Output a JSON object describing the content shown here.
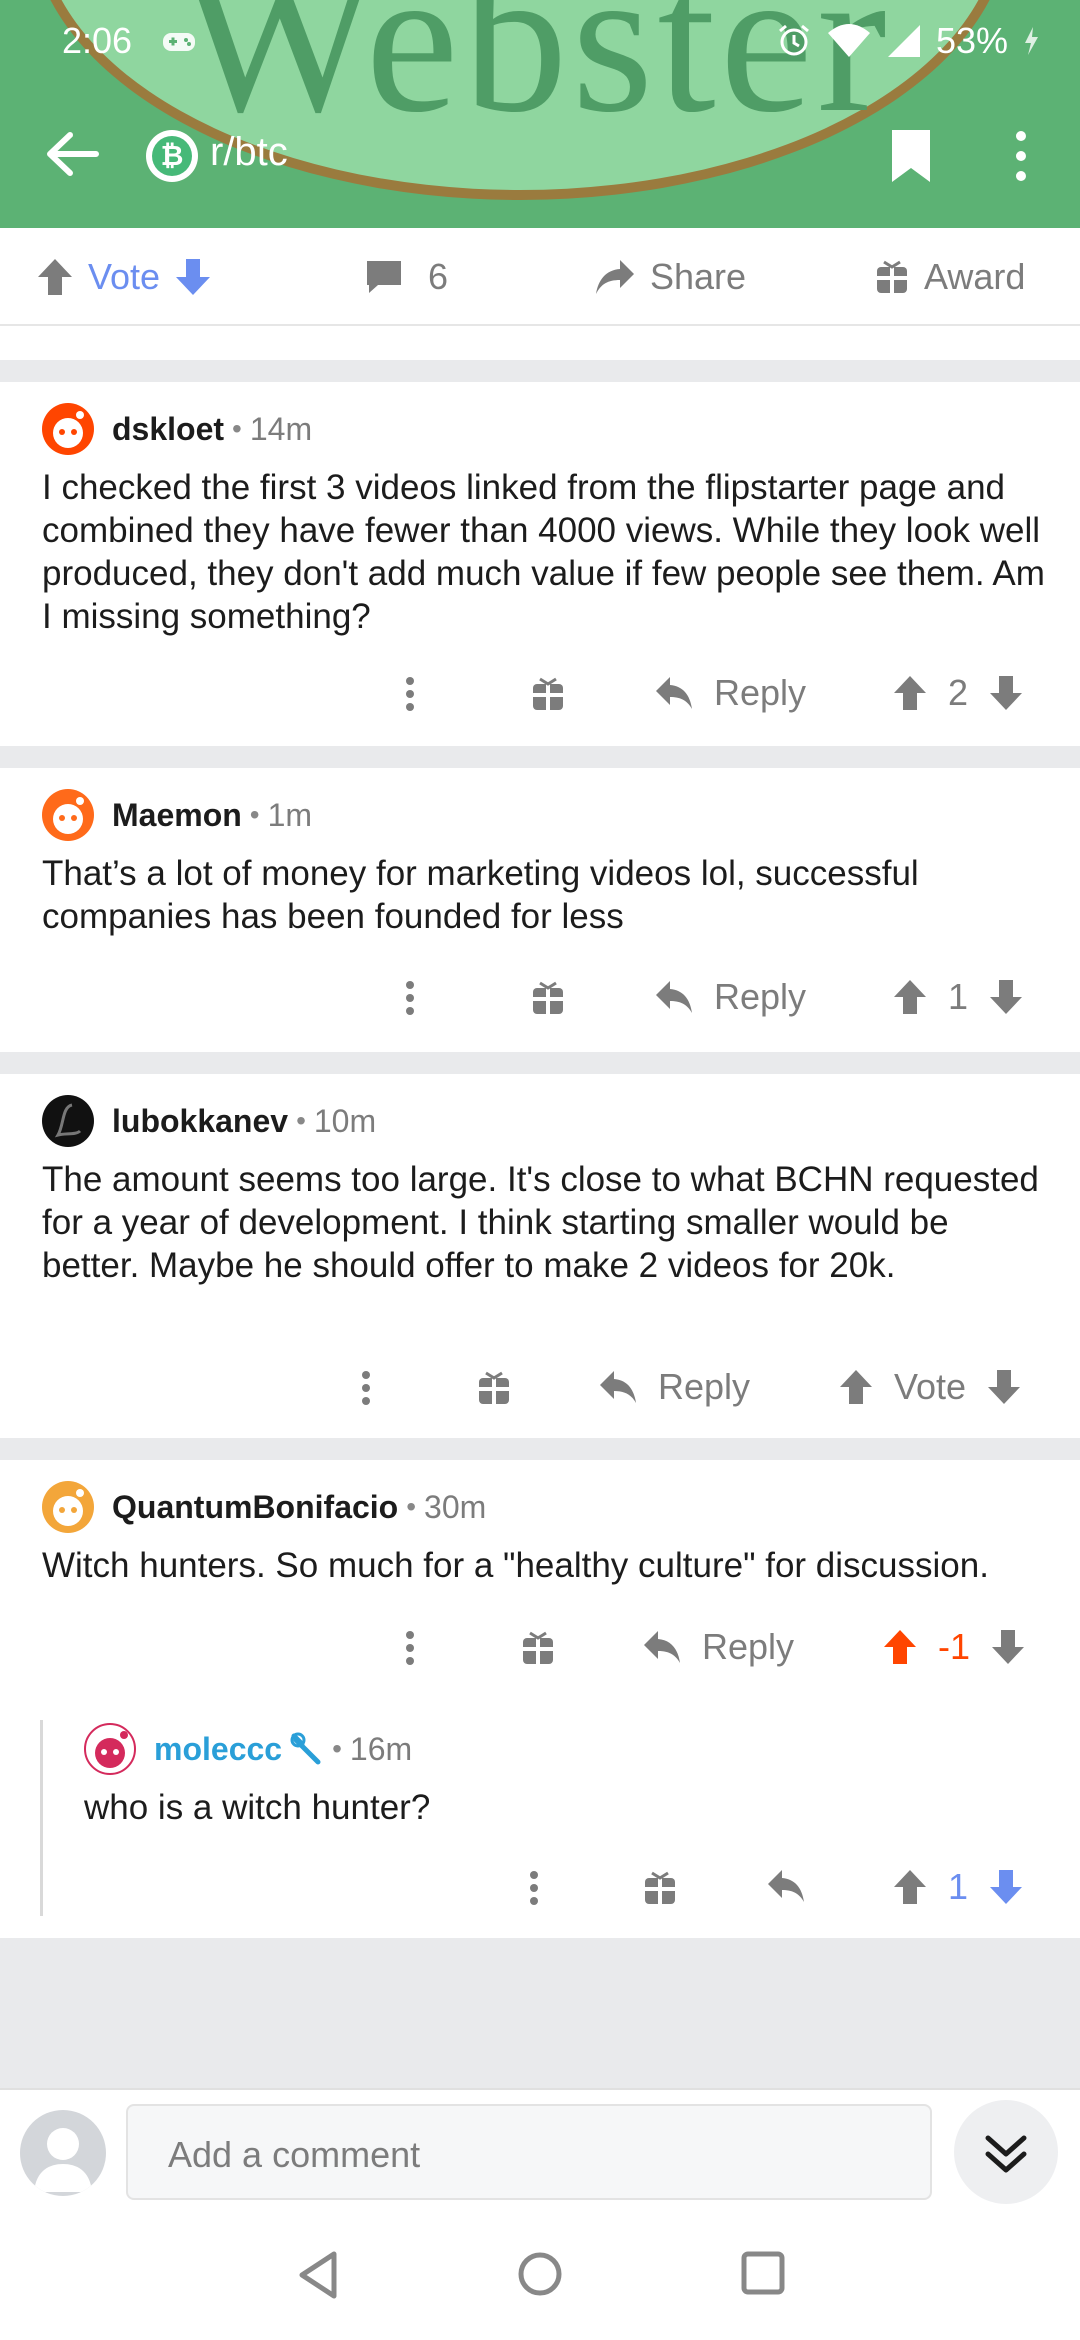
{
  "status": {
    "time": "2:06",
    "battery": "53%"
  },
  "header": {
    "subreddit": "r/btc",
    "coin_symbol": "₿"
  },
  "actions": {
    "vote": "Vote",
    "comments": "6",
    "share": "Share",
    "award": "Award"
  },
  "comments": [
    {
      "author": "dskloet",
      "age": "14m",
      "body": "I checked the first 3 videos linked from the flipstarter page and combined they have fewer than 4000 views. While they look well produced, they don't add much value if few people see them. Am I missing something?",
      "reply": "Reply",
      "score": "2",
      "avatar_color": "#ff4500"
    },
    {
      "author": "Maemon",
      "age": "1m",
      "body": "That’s a lot of money for marketing videos lol, successful companies has been founded for less",
      "reply": "Reply",
      "score": "1",
      "avatar_color": "#ff6a1a"
    },
    {
      "author": "lubokkanev",
      "age": "10m",
      "body": "The amount seems too large. It's close to what BCHN requested for a year of development. I think starting smaller would be better. Maybe he should offer to make 2 videos for 20k.",
      "reply": "Reply",
      "score": "Vote",
      "avatar_color": "#111111"
    },
    {
      "author": "QuantumBonifacio",
      "age": "30m",
      "body": "Witch hunters. So much for a \"healthy culture\" for discussion.",
      "reply": "Reply",
      "score": "-1",
      "avatar_color": "#f3a63a",
      "score_color": "#ff4500"
    },
    {
      "author": "moleccc",
      "age": "16m",
      "body": "who is a witch hunter?",
      "score": "1",
      "avatar_color": "#d42a5c",
      "author_color": "#2a9fd8",
      "score_color": "#6b8ef0"
    }
  ],
  "composer": {
    "placeholder": "Add a comment"
  },
  "colors": {
    "header": "#5cb274",
    "upvote": "#ff4500",
    "downvote": "#6b8ef0",
    "link": "#2a9fd8"
  }
}
